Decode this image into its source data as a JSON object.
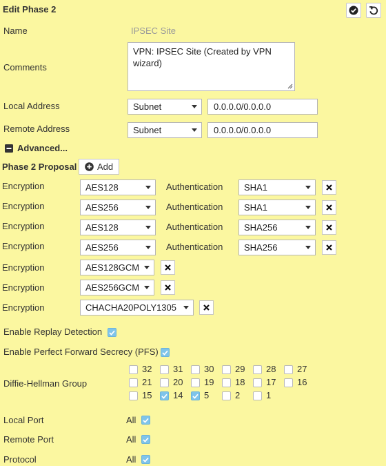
{
  "header": {
    "title": "Edit Phase 2",
    "ok_icon": "check-circle-icon",
    "revert_icon": "undo-icon"
  },
  "name": {
    "label": "Name",
    "value": "IPSEC Site"
  },
  "comments": {
    "label": "Comments",
    "value": "VPN: IPSEC Site (Created by VPN wizard)",
    "line1": "VPN: IPSEC Site (Created by VPN",
    "line2": "wizard)"
  },
  "local_address": {
    "label": "Local Address",
    "type": "Subnet",
    "value": "0.0.0.0/0.0.0.0"
  },
  "remote_address": {
    "label": "Remote Address",
    "type": "Subnet",
    "value": "0.0.0.0/0.0.0.0"
  },
  "advanced": {
    "label": "Advanced..."
  },
  "proposal": {
    "label": "Phase 2 Proposal",
    "add_label": "Add",
    "enc_label": "Encryption",
    "auth_label": "Authentication",
    "rows": [
      {
        "encryption": "AES128",
        "authentication": "SHA1"
      },
      {
        "encryption": "AES256",
        "authentication": "SHA1"
      },
      {
        "encryption": "AES128",
        "authentication": "SHA256"
      },
      {
        "encryption": "AES256",
        "authentication": "SHA256"
      },
      {
        "encryption": "AES128GCM"
      },
      {
        "encryption": "AES256GCM"
      },
      {
        "encryption": "CHACHA20POLY1305"
      }
    ]
  },
  "replay": {
    "label": "Enable Replay Detection",
    "checked": true
  },
  "pfs": {
    "label": "Enable Perfect Forward Secrecy (PFS)",
    "checked": true
  },
  "dh": {
    "label": "Diffie-Hellman Group",
    "groups": [
      {
        "value": "32",
        "checked": false
      },
      {
        "value": "31",
        "checked": false
      },
      {
        "value": "30",
        "checked": false
      },
      {
        "value": "29",
        "checked": false
      },
      {
        "value": "28",
        "checked": false
      },
      {
        "value": "27",
        "checked": false
      },
      {
        "value": "21",
        "checked": false
      },
      {
        "value": "20",
        "checked": false
      },
      {
        "value": "19",
        "checked": false
      },
      {
        "value": "18",
        "checked": false
      },
      {
        "value": "17",
        "checked": false
      },
      {
        "value": "16",
        "checked": false
      },
      {
        "value": "15",
        "checked": false
      },
      {
        "value": "14",
        "checked": true
      },
      {
        "value": "5",
        "checked": true
      },
      {
        "value": "2",
        "checked": false
      },
      {
        "value": "1",
        "checked": false
      }
    ]
  },
  "local_port": {
    "label": "Local Port",
    "value": "All",
    "checked": true
  },
  "remote_port": {
    "label": "Remote Port",
    "value": "All",
    "checked": true
  },
  "protocol": {
    "label": "Protocol",
    "value": "All",
    "checked": true
  }
}
